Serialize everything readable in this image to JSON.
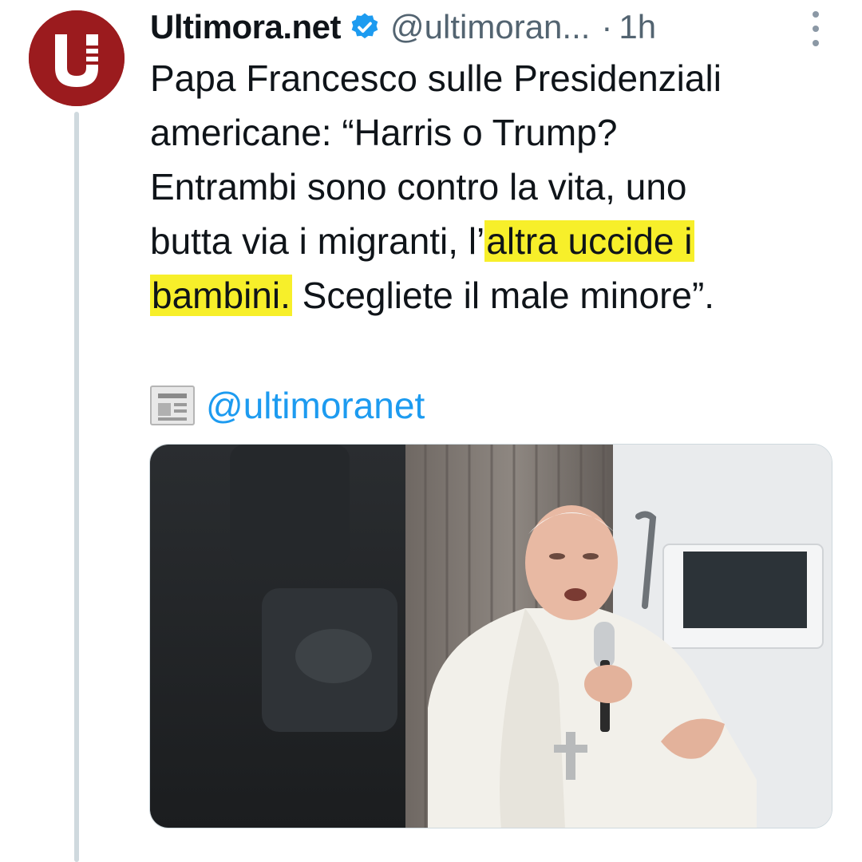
{
  "tweet": {
    "author_name": "Ultimora.net",
    "author_handle": "@ultimoran...",
    "separator": "·",
    "timestamp": "1h",
    "verified": true,
    "text": {
      "line1": "Papa Francesco sulle Presidenziali",
      "line2": "americane: “Harris o Trump?",
      "line3": "Entrambi sono contro la vita, uno",
      "line4_plain": "butta via i migranti, l’",
      "line4_highlight": "altra uccide i",
      "line5_highlight": "bambini.",
      "line5_plain": " Scegliete il male minore”."
    },
    "source_icon": "newspaper-icon",
    "source_mention": "@ultimoranet"
  },
  "colors": {
    "avatar_bg": "#9b1b1e",
    "verified_badge": "#1d9bf0",
    "link": "#1d9bf0",
    "highlight": "#f7ef2a",
    "muted_text": "#536471"
  }
}
